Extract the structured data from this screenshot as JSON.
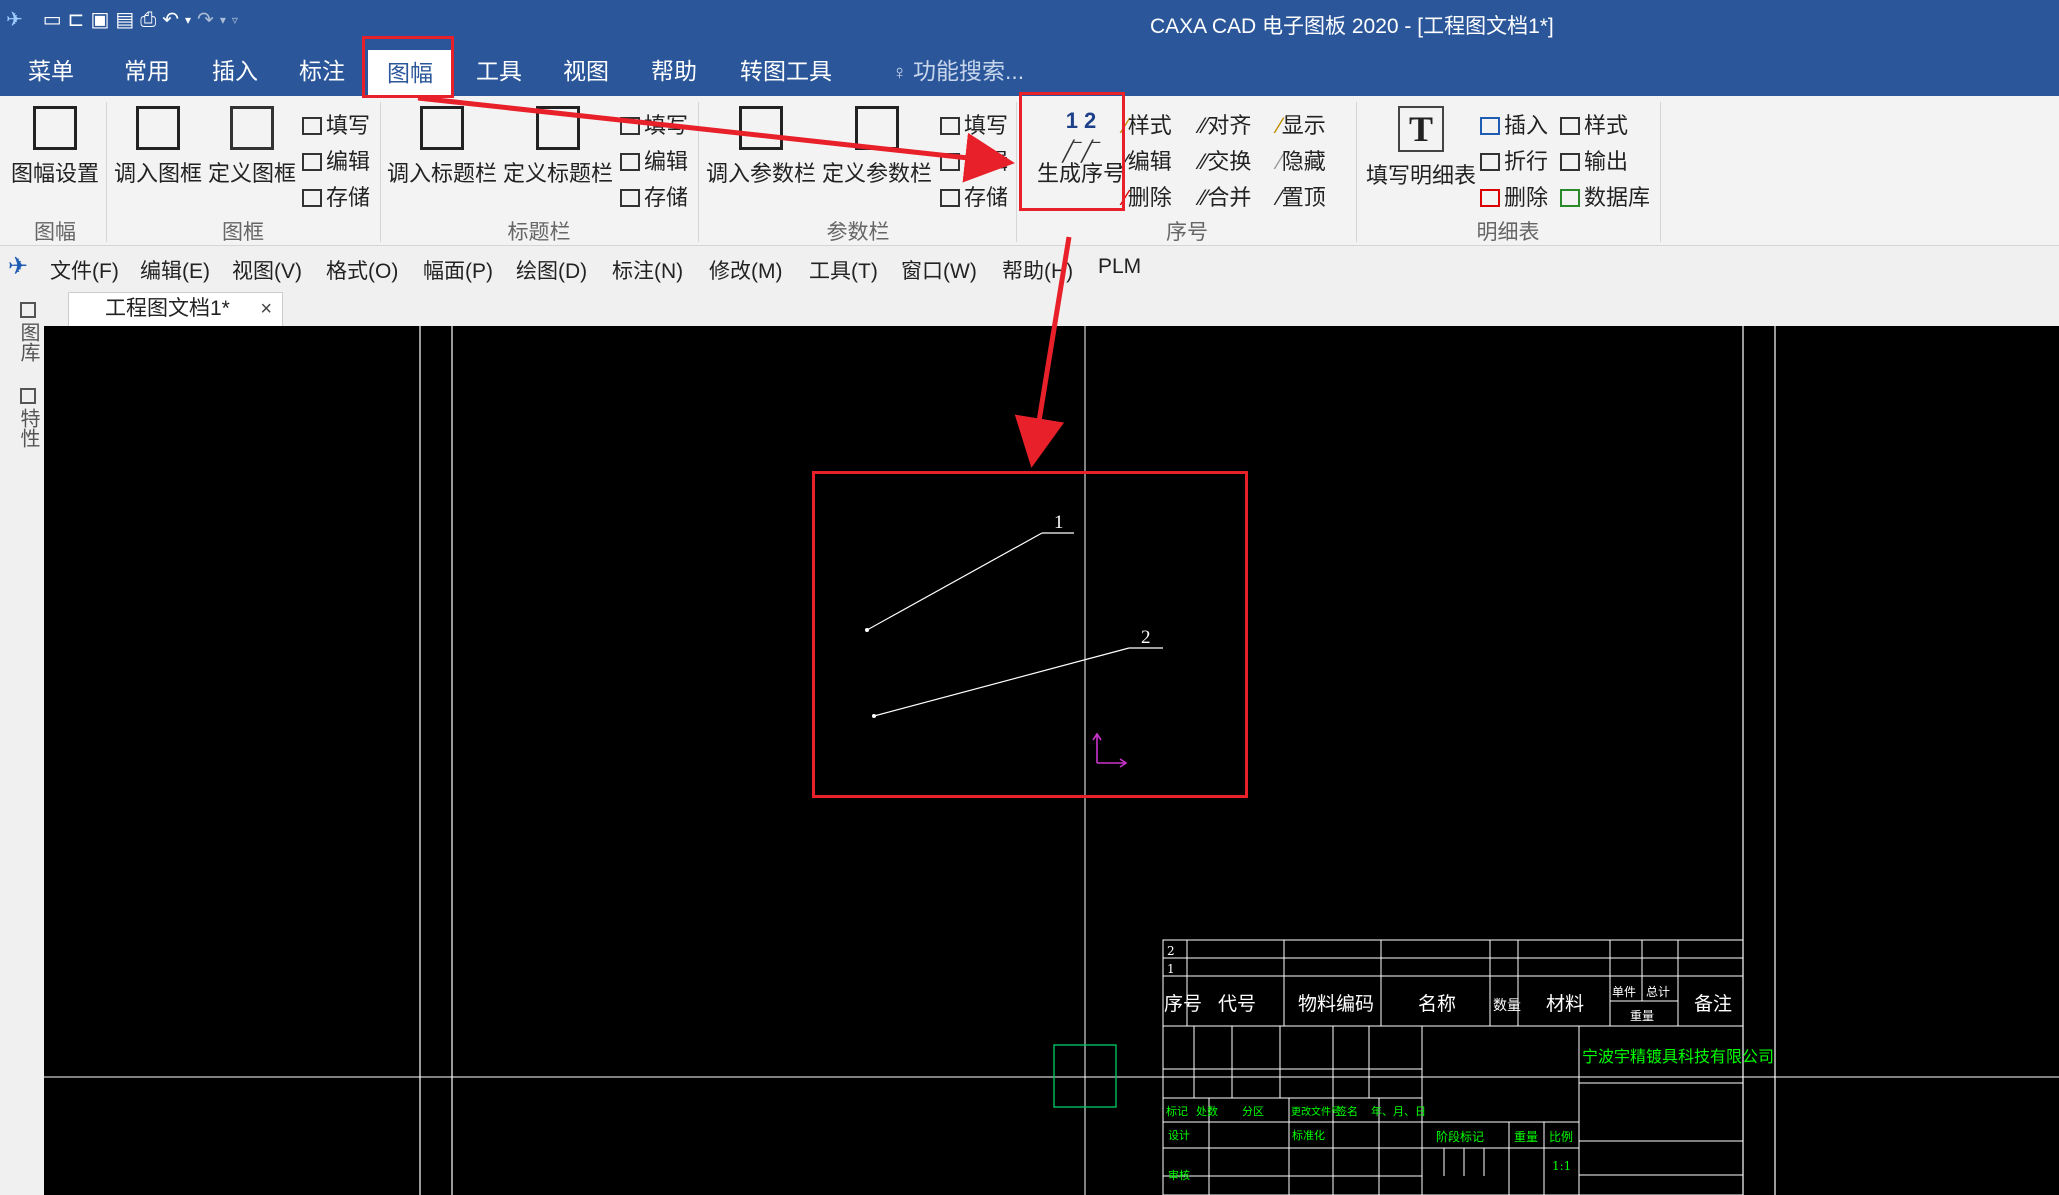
{
  "titlebar": {
    "title": "CAXA CAD 电子图板 2020 - [工程图文档1*]"
  },
  "tabs": [
    "菜单",
    "常用",
    "插入",
    "标注",
    "图幅",
    "工具",
    "视图",
    "帮助",
    "转图工具"
  ],
  "search": {
    "placeholder": "功能搜索..."
  },
  "ribbon": {
    "tufu_setup": "图幅设置",
    "load_frame": "调入图框",
    "define_frame": "定义图框",
    "frame_fill": "填写",
    "frame_edit": "编辑",
    "frame_save": "存储",
    "load_titleblock": "调入标题栏",
    "define_titleblock": "定义标题栏",
    "tb_fill": "填写",
    "tb_edit": "编辑",
    "tb_save": "存储",
    "load_param": "调入参数栏",
    "define_param": "定义参数栏",
    "pb_fill": "填写",
    "pb_edit": "编辑",
    "pb_save": "存储",
    "gen_seq": "生成序号",
    "gen_seq_icon_text": "1 2",
    "seq_style": "样式",
    "seq_edit": "编辑",
    "seq_delete": "删除",
    "seq_align": "对齐",
    "seq_swap": "交换",
    "seq_merge": "合并",
    "seq_show": "显示",
    "seq_hide": "隐藏",
    "seq_top": "置顶",
    "fill_bom": "填写明细表",
    "bom_insert": "插入",
    "bom_fold": "折行",
    "bom_delete": "删除",
    "bom_style": "样式",
    "bom_output": "输出",
    "bom_db": "数据库",
    "groups": {
      "tufu": "图幅",
      "frame": "图框",
      "titleblock": "标题栏",
      "param": "参数栏",
      "seq": "序号",
      "bom": "明细表"
    }
  },
  "menubar": [
    "文件(F)",
    "编辑(E)",
    "视图(V)",
    "格式(O)",
    "幅面(P)",
    "绘图(D)",
    "标注(N)",
    "修改(M)",
    "工具(T)",
    "窗口(W)",
    "帮助(H)",
    "PLM"
  ],
  "document": {
    "tab": "工程图文档1*",
    "close": "×"
  },
  "side_tabs": [
    "图库",
    "特性"
  ],
  "drawing": {
    "balloons": [
      "1",
      "2"
    ],
    "bom_rows": [
      "2",
      "1"
    ],
    "bom_header": [
      "序号",
      "代号",
      "物料编码",
      "名称",
      "数量",
      "材料",
      "单件",
      "总计",
      "重量",
      "备注"
    ],
    "company": "宁波宇精镀具科技有限公司",
    "tb_labels": [
      "标记",
      "处数",
      "分区",
      "更改文件号",
      "签名",
      "年、月、日"
    ],
    "tb_row2": [
      "设计",
      "标准化",
      "阶段标记",
      "重量",
      "比例"
    ],
    "scale": "1:1",
    "review": "审核"
  },
  "colors": {
    "ribbon_blue": "#2b579a",
    "annotation_red": "#e8202a",
    "bom_green": "#00ff00"
  }
}
